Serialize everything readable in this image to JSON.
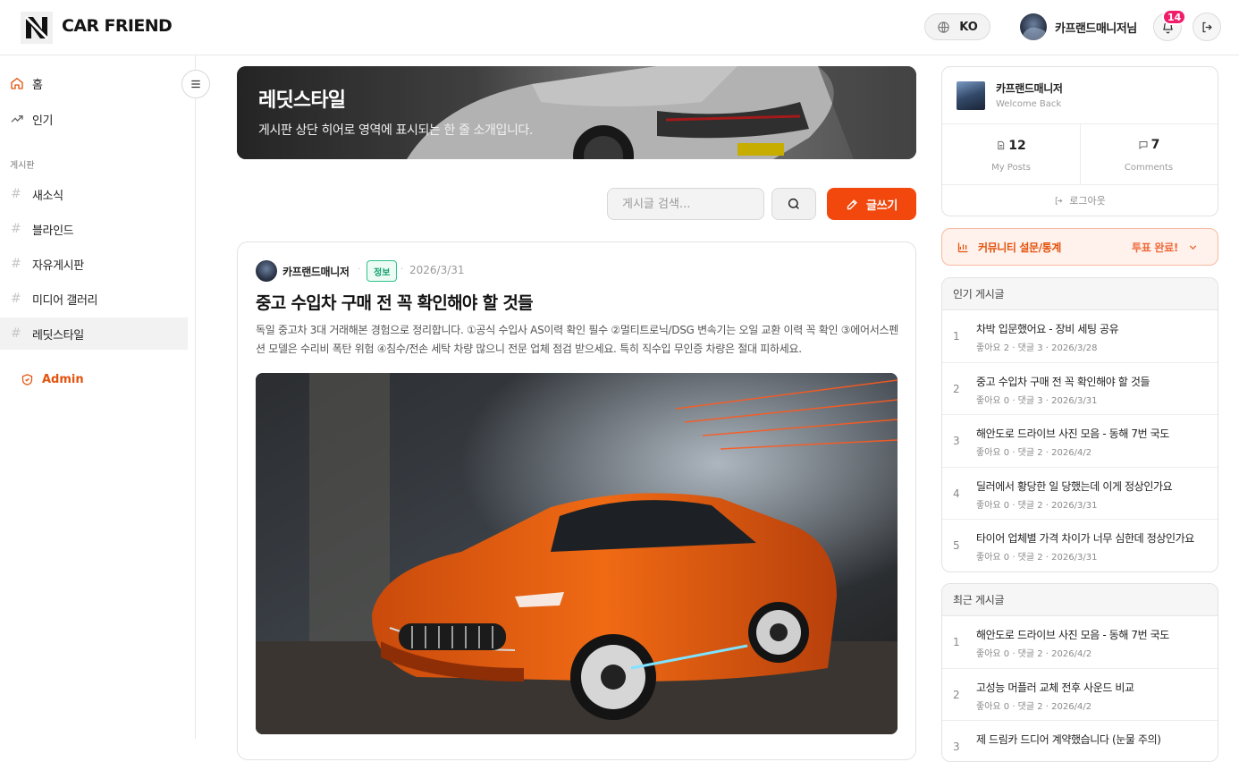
{
  "header": {
    "brand": "CAR FRIEND",
    "language": "KO",
    "user_name": "카프랜드매니저님",
    "notification_count": "14"
  },
  "sidebar": {
    "main_items": [
      {
        "label": "홈",
        "icon": "home-icon"
      },
      {
        "label": "인기",
        "icon": "trending-icon"
      }
    ],
    "section_label": "게시판",
    "boards": [
      {
        "label": "새소식"
      },
      {
        "label": "블라인드"
      },
      {
        "label": "자유게시판"
      },
      {
        "label": "미디어 갤러리"
      },
      {
        "label": "레딧스타일",
        "active": true
      }
    ],
    "admin_label": "Admin"
  },
  "hero": {
    "title": "레딧스타일",
    "subtitle": "게시판 상단 히어로 영역에 표시되는 한 줄 소개입니다."
  },
  "toolbar": {
    "search_placeholder": "게시글 검색...",
    "write_label": "글쓰기"
  },
  "post": {
    "author": "카프랜드매니저",
    "tag": "정보",
    "date": "2026/3/31",
    "title": "중고 수입차 구매 전 꼭 확인해야 할 것들",
    "body": "독일 중고차 3대 거래해본 경험으로 정리합니다. ①공식 수입사 AS이력 확인 필수 ②멀티트로닉/DSG 변속기는 오일 교환 이력 꼭 확인 ③에어서스펜션 모델은 수리비 폭탄 위험 ④침수/전손 세탁 차량 많으니 전문 업체 점검 받으세요. 특히 직수입 무인증 차량은 절대 피하세요."
  },
  "profile": {
    "name": "카프랜드매니저",
    "welcome": "Welcome Back",
    "posts_count": "12",
    "posts_label": "My Posts",
    "comments_count": "7",
    "comments_label": "Comments",
    "logout_label": "로그아웃"
  },
  "survey": {
    "title": "커뮤니티 설문/통계",
    "status": "투표 완료!"
  },
  "popular": {
    "header": "인기 게시글",
    "items": [
      {
        "rank": "1",
        "title": "차박 입문했어요 - 장비 세팅 공유",
        "meta": "좋아요 2 · 댓글 3 · 2026/3/28"
      },
      {
        "rank": "2",
        "title": "중고 수입차 구매 전 꼭 확인해야 할 것들",
        "meta": "좋아요 0 · 댓글 3 · 2026/3/31"
      },
      {
        "rank": "3",
        "title": "해안도로 드라이브 사진 모음 - 동해 7번 국도",
        "meta": "좋아요 0 · 댓글 2 · 2026/4/2"
      },
      {
        "rank": "4",
        "title": "딜러에서 황당한 일 당했는데 이게 정상인가요",
        "meta": "좋아요 0 · 댓글 2 · 2026/3/31"
      },
      {
        "rank": "5",
        "title": "타이어 업체별 가격 차이가 너무 심한데 정상인가요",
        "meta": "좋아요 0 · 댓글 2 · 2026/3/31"
      }
    ]
  },
  "recent": {
    "header": "최근 게시글",
    "items": [
      {
        "rank": "1",
        "title": "해안도로 드라이브 사진 모음 - 동해 7번 국도",
        "meta": "좋아요 0 · 댓글 2 · 2026/4/2"
      },
      {
        "rank": "2",
        "title": "고성능 머플러 교체 전후 사운드 비교",
        "meta": "좋아요 0 · 댓글 2 · 2026/4/2"
      },
      {
        "rank": "3",
        "title": "제 드림카 드디어 계약했습니다 (눈물 주의)",
        "meta": ""
      }
    ]
  },
  "colors": {
    "accent": "#f2480e",
    "admin": "#e2530d",
    "badge": "#ef1d6a",
    "tag": "#13a06a"
  }
}
